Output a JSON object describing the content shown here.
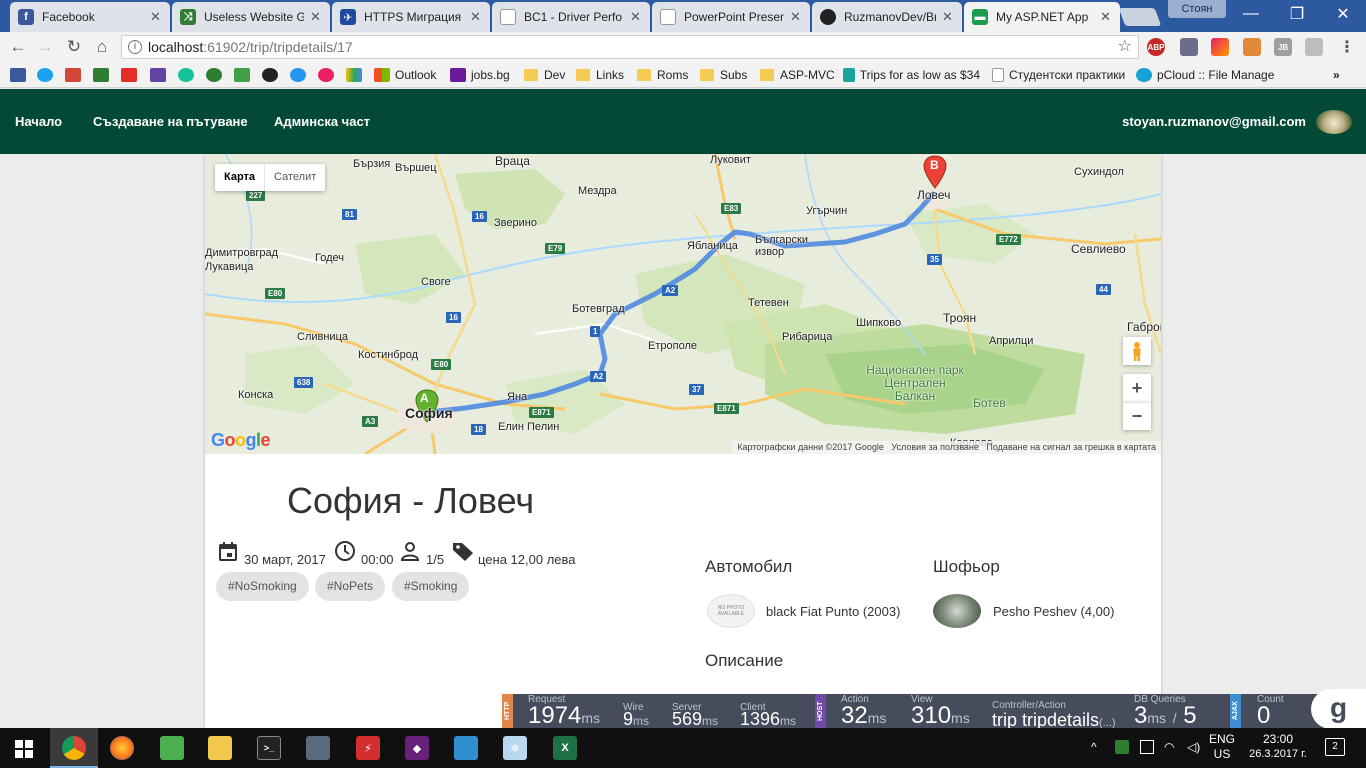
{
  "browser": {
    "tabs": [
      {
        "title": "Facebook",
        "icon": "facebook-icon",
        "color": "#3b5998"
      },
      {
        "title": "Useless Website G",
        "icon": "shuffle-icon",
        "color": "#2e7d32"
      },
      {
        "title": "HTTPS Миграция",
        "icon": "plane-icon",
        "color": "#1e4aa0"
      },
      {
        "title": "BC1 - Driver Perfo",
        "icon": "document-icon",
        "color": "#888888"
      },
      {
        "title": "PowerPoint Presen",
        "icon": "document-icon",
        "color": "#888888"
      },
      {
        "title": "RuzmanovDev/Bru",
        "icon": "github-icon",
        "color": "#222222"
      },
      {
        "title": "My ASP.NET App",
        "icon": "car-icon",
        "color": "#1b9e4b"
      }
    ],
    "window_user": "Стоян",
    "url_host": "localhost",
    "url_rest": ":61902/trip/tripdetails/17",
    "bookmarks": [
      {
        "label": "Outlook",
        "type": "site",
        "color": "#e8532e"
      },
      {
        "label": "jobs.bg",
        "type": "site",
        "color": "#6a1b9a"
      },
      {
        "label": "Dev",
        "type": "folder"
      },
      {
        "label": "Links",
        "type": "folder"
      },
      {
        "label": "Roms",
        "type": "folder"
      },
      {
        "label": "Subs",
        "type": "folder"
      },
      {
        "label": "ASP-MVC",
        "type": "folder"
      },
      {
        "label": "Trips for as low as $34",
        "type": "site",
        "color": "#1aa39a"
      },
      {
        "label": "Студентски практики",
        "type": "page"
      },
      {
        "label": "pCloud :: File Manage",
        "type": "site",
        "color": "#17a2d6"
      }
    ],
    "overflow": "»"
  },
  "site_nav": {
    "links": [
      "Начало",
      "Създаване на пътуване",
      "Админска част"
    ],
    "user_email": "stoyan.ruzmanov@gmail.com"
  },
  "map": {
    "type_options": [
      "Карта",
      "Сателит"
    ],
    "selected_type": "Карта",
    "marker_a": "A",
    "marker_b": "B",
    "zoom_in": "+",
    "zoom_out": "−",
    "logo": "Google",
    "footer": [
      "Картографски данни ©2017 Google",
      "Условия за ползване",
      "Подаване на сигнал за грешка в картата"
    ],
    "places": [
      {
        "name": "Бързия"
      },
      {
        "name": "Вършец"
      },
      {
        "name": "Враца"
      },
      {
        "name": "Луковит"
      },
      {
        "name": "Мездра"
      },
      {
        "name": "Сухиндол"
      },
      {
        "name": "Ловеч",
        "major": true
      },
      {
        "name": "Угърчин"
      },
      {
        "name": "Зверино"
      },
      {
        "name": "Ябланица"
      },
      {
        "name": "Български извор"
      },
      {
        "name": "Севлиево"
      },
      {
        "name": "Годеч"
      },
      {
        "name": "Своге"
      },
      {
        "name": "Ботевград"
      },
      {
        "name": "Тетевен"
      },
      {
        "name": "Сливница"
      },
      {
        "name": "Шипково"
      },
      {
        "name": "Троян"
      },
      {
        "name": "Габрово"
      },
      {
        "name": "Костинброд"
      },
      {
        "name": "Етрополе"
      },
      {
        "name": "Рибарица"
      },
      {
        "name": "Априлци"
      },
      {
        "name": "Конска"
      },
      {
        "name": "София",
        "major": true
      },
      {
        "name": "Яна"
      },
      {
        "name": "Елин Пелин"
      },
      {
        "name": "Димитровград"
      },
      {
        "name": "Лукавица"
      },
      {
        "name": "Национален парк Централен Балкан"
      },
      {
        "name": "Ботев"
      },
      {
        "name": "Карлово"
      }
    ],
    "roads": [
      "81",
      "16",
      "E79",
      "E83",
      "E772",
      "35",
      "44",
      "E80",
      "16",
      "A2",
      "1",
      "A2",
      "E80",
      "638",
      "37",
      "E871",
      "E871",
      "A3",
      "18",
      "227"
    ]
  },
  "trip": {
    "title": "София - Ловеч",
    "date": "30 март, 2017",
    "time": "00:00",
    "seats": "1/5",
    "price": "цена 12,00 лева",
    "tags": [
      "#NoSmoking",
      "#NoPets",
      "#Smoking"
    ],
    "car_heading": "Автомобил",
    "car": "black Fiat Punto (2003)",
    "car_photo_text": "NO PHOTO AVAILABLE",
    "driver_heading": "Шофьор",
    "driver": "Pesho Peshev (4,00)",
    "description_heading": "Описание"
  },
  "glimpse": {
    "http_label": "HTTP",
    "host_label": "HOST",
    "ajax_label": "AJAX",
    "request": {
      "label": "Request",
      "value": "1974",
      "unit": "ms"
    },
    "wire": {
      "label": "Wire",
      "value": "9",
      "unit": "ms"
    },
    "server": {
      "label": "Server",
      "value": "569",
      "unit": "ms"
    },
    "client": {
      "label": "Client",
      "value": "1396",
      "unit": "ms"
    },
    "action": {
      "label": "Action",
      "value": "32",
      "unit": "ms"
    },
    "view": {
      "label": "View",
      "value": "310",
      "unit": "ms"
    },
    "controller": {
      "label": "Controller/Action",
      "value": "trip tripdetails",
      "suffix": "(...)"
    },
    "db": {
      "label": "DB Queries",
      "value": "3",
      "unit": "ms",
      "count": "5",
      "sep": "/"
    },
    "count": {
      "label": "Count",
      "value": "0"
    },
    "logo": "g"
  },
  "taskbar": {
    "lang": "ENG",
    "region": "US",
    "time": "23:00",
    "date": "26.3.2017 г.",
    "notifications": "2"
  }
}
